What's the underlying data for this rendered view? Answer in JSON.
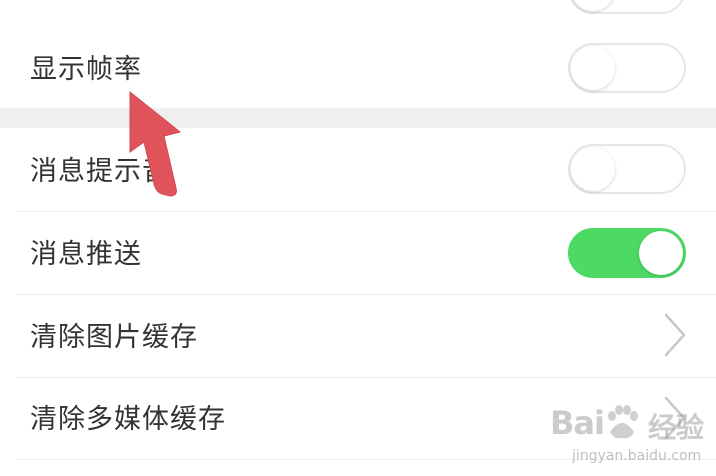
{
  "settings": {
    "rows": [
      {
        "label": "显示帧率",
        "control": "toggle",
        "state": "off"
      },
      {
        "label": "消息提示音",
        "control": "toggle",
        "state": "off"
      },
      {
        "label": "消息推送",
        "control": "toggle",
        "state": "on"
      },
      {
        "label": "清除图片缓存",
        "control": "chevron"
      },
      {
        "label": "清除多媒体缓存",
        "control": "chevron"
      }
    ]
  },
  "colors": {
    "toggle_on": "#4cd964",
    "pointer_arrow": "#e0535b",
    "section_gap": "#efefef"
  },
  "watermark": {
    "brand": "Bai",
    "brand_cn": "经验",
    "url": "jingyan.baidu.com"
  },
  "icons": [
    "chevron-right-icon",
    "pointer-arrow-icon",
    "baidu-paw-icon"
  ]
}
